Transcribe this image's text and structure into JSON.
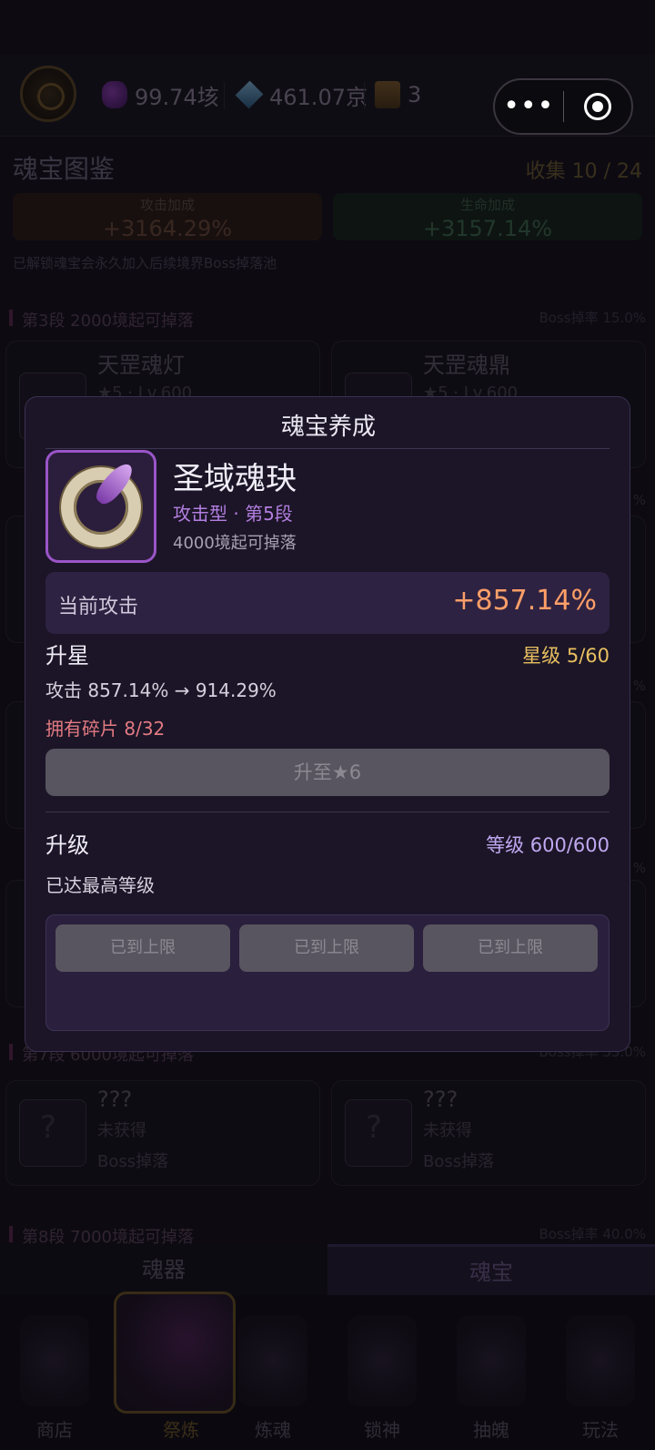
{
  "header": {
    "resources": [
      {
        "icon": "purple-soul-gem-icon",
        "value": "99.74垓"
      },
      {
        "icon": "blue-crystal-icon",
        "value": "461.07京"
      },
      {
        "icon": "treasure-chest-icon",
        "value": "3"
      }
    ],
    "capsule": {
      "more_icon": "more-dots-icon",
      "close_icon": "target-close-icon",
      "more_glyph": "•••"
    }
  },
  "codex": {
    "title": "魂宝图鉴",
    "collect": "收集 10 / 24",
    "attack_bonus": {
      "label": "攻击加成",
      "value": "+3164.29%"
    },
    "hp_bonus": {
      "label": "生命加成",
      "value": "+3157.14%"
    },
    "note": "已解锁魂宝会永久加入后续境界Boss掉落池",
    "tiers": [
      {
        "label": "第3段  2000境起可掉落",
        "rate": "Boss掉率 15.0%"
      },
      {
        "label": "第7段  6000境起可掉落",
        "rate": "Boss掉率 35.0%"
      },
      {
        "label": "第8段  7000境起可掉落",
        "rate": "Boss掉率 40.0%"
      }
    ],
    "cards": [
      {
        "name": "天罡魂灯",
        "sub": "★5 · Lv.600"
      },
      {
        "name": "天罡魂鼎",
        "sub": "★5 · Lv.600"
      },
      {
        "name": "???",
        "sub": "未获得",
        "sub2": "Boss掉落"
      },
      {
        "name": "???",
        "sub": "未获得",
        "sub2": "Boss掉落"
      }
    ],
    "partial_rates": [
      "%",
      "%",
      "%"
    ]
  },
  "seg_tabs": {
    "left": "魂器",
    "right": "魂宝"
  },
  "nav": [
    {
      "label": "商店",
      "icon": "shop-chest-icon"
    },
    {
      "label": "祭炼",
      "icon": "skeleton-banner-icon"
    },
    {
      "label": "炼魂",
      "icon": "skull-orb-icon"
    },
    {
      "label": "锁神",
      "icon": "chain-lock-icon"
    },
    {
      "label": "抽魄",
      "icon": "gacha-portal-icon"
    },
    {
      "label": "玩法",
      "icon": "crystal-ball-icon"
    }
  ],
  "modal": {
    "title": "魂宝养成",
    "item": {
      "name": "圣域魂玦",
      "type": "攻击型 · 第5段",
      "drop": "4000境起可掉落",
      "icon": "jade-ring-icon"
    },
    "current": {
      "label": "当前攻击",
      "value": "+857.14%"
    },
    "star": {
      "title": "升星",
      "level": "星级 5/60",
      "attack": "攻击 857.14% → 914.29%",
      "fragments": "拥有碎片 8/32",
      "button": "升至★6"
    },
    "upgrade": {
      "title": "升级",
      "level": "等级 600/600",
      "status": "已达最高等级",
      "buttons": [
        "已到上限",
        "已到上限",
        "已到上限"
      ]
    }
  }
}
